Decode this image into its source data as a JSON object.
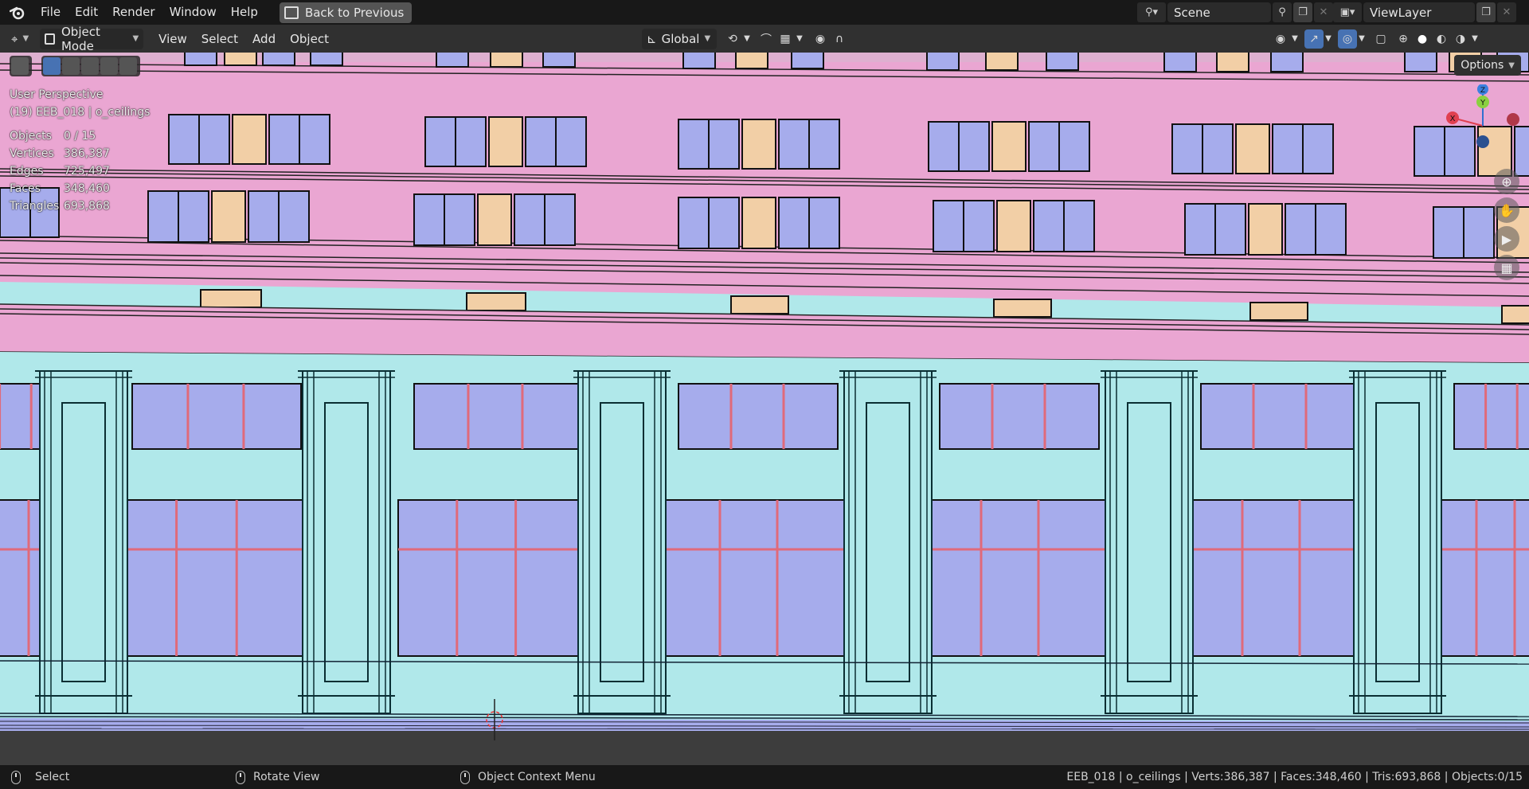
{
  "topbar": {
    "menus": [
      "File",
      "Edit",
      "Render",
      "Window",
      "Help"
    ],
    "back_button": "Back to Previous",
    "scene_name": "Scene",
    "view_layer": "ViewLayer"
  },
  "header": {
    "mode": "Object Mode",
    "menus": [
      "View",
      "Select",
      "Add",
      "Object"
    ],
    "orientation": "Global"
  },
  "viewport": {
    "perspective": "User Perspective",
    "object_info": "(19) EEB_018 | o_ceilings",
    "stats": [
      {
        "label": "Objects",
        "value": "0 / 15"
      },
      {
        "label": "Vertices",
        "value": "386,387"
      },
      {
        "label": "Edges",
        "value": "725,497"
      },
      {
        "label": "Faces",
        "value": "348,460"
      },
      {
        "label": "Triangles",
        "value": "693,868"
      }
    ],
    "options_label": "Options",
    "gizmo_axes": [
      "X",
      "Y",
      "Z"
    ],
    "colors": {
      "wall_pink": "#eaa6d2",
      "base_cyan": "#b0e8ea",
      "glass": "#a6acec",
      "frame_tan": "#f2cfa6",
      "mullion_red": "#e06a7a"
    }
  },
  "statusbar": {
    "select": "Select",
    "rotate": "Rotate View",
    "context": "Object Context Menu",
    "info": "EEB_018 | o_ceilings | Verts:386,387 | Faces:348,460 | Tris:693,868 | Objects:0/15"
  }
}
